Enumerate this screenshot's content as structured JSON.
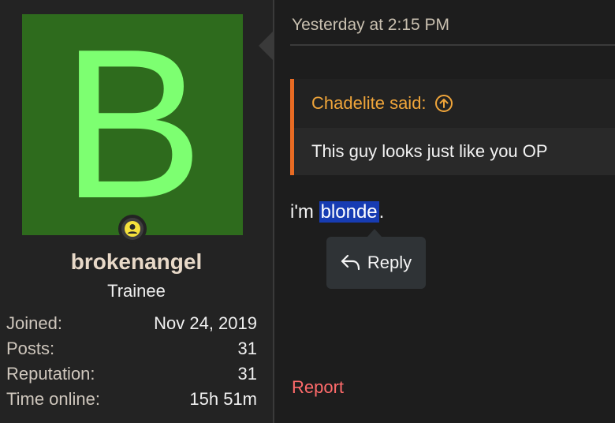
{
  "user": {
    "avatar_letter": "B",
    "avatar_bg": "#2e6b1d",
    "avatar_fg": "#7dff71",
    "status_icon": "user-online-icon",
    "username": "brokenangel",
    "title": "Trainee",
    "stats": [
      {
        "label": "Joined:",
        "value": "Nov 24, 2019"
      },
      {
        "label": "Posts:",
        "value": "31"
      },
      {
        "label": "Reputation:",
        "value": "31"
      },
      {
        "label": "Time online:",
        "value": "15h 51m"
      }
    ]
  },
  "post": {
    "date": "Yesterday at 2:15 PM",
    "quote": {
      "author_label": "Chadelite said:",
      "jump_icon": "arrow-up-circle-icon",
      "text": "This guy looks just like you OP",
      "accent": "#e86b23"
    },
    "body_prefix": "i'm ",
    "body_selected": "blonde",
    "body_suffix": ".",
    "selection_color": "#173cb3"
  },
  "selection_menu": {
    "reply_icon": "reply-icon",
    "reply_label": "Reply"
  },
  "actions": {
    "report_label": "Report",
    "report_color": "#ff6b6b"
  }
}
